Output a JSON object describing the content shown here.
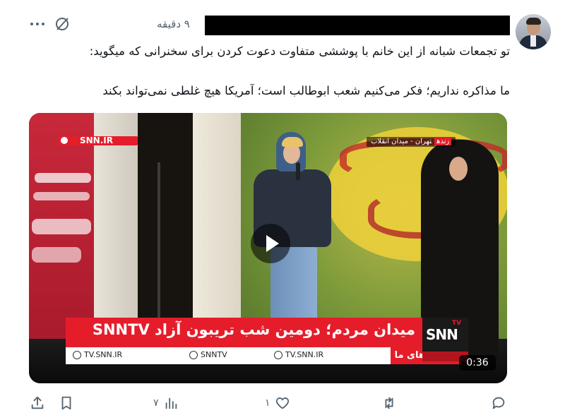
{
  "post": {
    "time": "۹ دقیقه",
    "text_line1": "تو تجمعات شبانه از این خانم با پوششی متفاوت دعوت کردن برای سخنرانی که میگوید:",
    "text_line2": "ما مذاکره نداریم؛ فکر می‌کنیم شعب ابوطالب است؛ آمریکا هیچ غلطی نمی‌تواند بکند"
  },
  "video": {
    "top_logo": "SNN.IR",
    "live_word": "زنده",
    "live_location": "تهران - میدان انقلاب",
    "headline": "میدان مردم؛ دومین شب تریبون آزاد SNNTV",
    "address_label": "نشانی های ما",
    "handles": [
      "TV.SNN.IR",
      "SNNTV",
      "TV.SNN.IR"
    ],
    "corner_logo": "SNN",
    "corner_logo_tv": "TV",
    "duration": "0:36"
  },
  "actions": {
    "views": "۷",
    "likes": "۱"
  },
  "icons": {
    "more": "more-horizontal-icon",
    "grok": "grok-icon",
    "share": "share-icon",
    "bookmark": "bookmark-icon",
    "views": "views-icon",
    "like": "heart-icon",
    "repost": "repost-icon",
    "reply": "reply-icon",
    "play": "play-icon"
  },
  "colors": {
    "text_primary": "#0f1419",
    "text_secondary": "#536471",
    "broadcast_red": "#e51d2b"
  }
}
